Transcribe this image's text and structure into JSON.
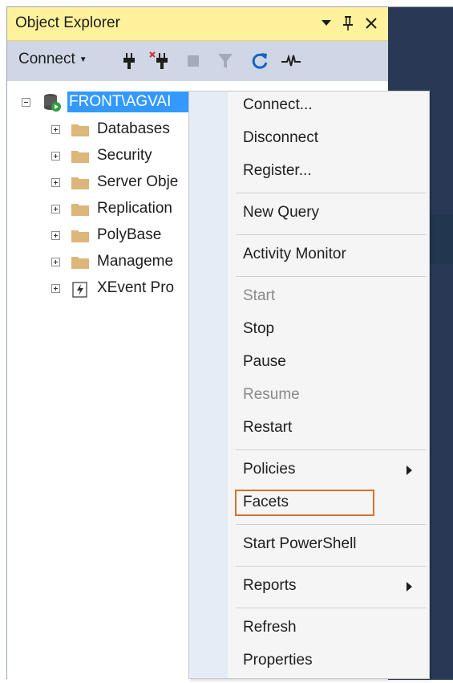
{
  "panel": {
    "title": "Object Explorer",
    "title_icons": [
      "dropdown-caret-icon",
      "pin-icon",
      "close-icon"
    ],
    "pin_glyph": "ꟼ",
    "close_glyph": "✕"
  },
  "toolbar": {
    "connect_label": "Connect",
    "caret": "▾",
    "tools": [
      "connect-plug-icon",
      "disconnect-plug-icon",
      "stop-icon",
      "filter-icon",
      "refresh-icon",
      "activity-monitor-icon"
    ]
  },
  "tree": {
    "root": "FRONT\\AGVAI",
    "children": [
      {
        "label": "Databases",
        "icon": "folder-icon"
      },
      {
        "label": "Security",
        "icon": "folder-icon"
      },
      {
        "label": "Server Obje",
        "icon": "folder-icon"
      },
      {
        "label": "Replication",
        "icon": "folder-icon"
      },
      {
        "label": "PolyBase",
        "icon": "folder-icon"
      },
      {
        "label": "Manageme",
        "icon": "folder-icon"
      },
      {
        "label": "XEvent Pro",
        "icon": "xevent-profiler-icon"
      }
    ]
  },
  "context_menu": {
    "items": [
      {
        "label": "Connect...",
        "enabled": true
      },
      {
        "label": "Disconnect",
        "enabled": true
      },
      {
        "label": "Register...",
        "enabled": true
      },
      {
        "label": "New Query",
        "enabled": true
      },
      {
        "label": "Activity Monitor",
        "enabled": true
      },
      {
        "label": "Start",
        "enabled": false
      },
      {
        "label": "Stop",
        "enabled": true
      },
      {
        "label": "Pause",
        "enabled": true
      },
      {
        "label": "Resume",
        "enabled": false
      },
      {
        "label": "Restart",
        "enabled": true
      },
      {
        "label": "Policies",
        "enabled": true,
        "submenu": true
      },
      {
        "label": "Facets",
        "enabled": true,
        "highlighted": true
      },
      {
        "label": "Start PowerShell",
        "enabled": true
      },
      {
        "label": "Reports",
        "enabled": true,
        "submenu": true
      },
      {
        "label": "Refresh",
        "enabled": true
      },
      {
        "label": "Properties",
        "enabled": true
      }
    ]
  },
  "colors": {
    "title_bar": "#fff29d",
    "toolbar": "#cfd6e5",
    "selection": "#3399ff",
    "highlight_box": "#d0732e",
    "background_dark": "#293955"
  }
}
